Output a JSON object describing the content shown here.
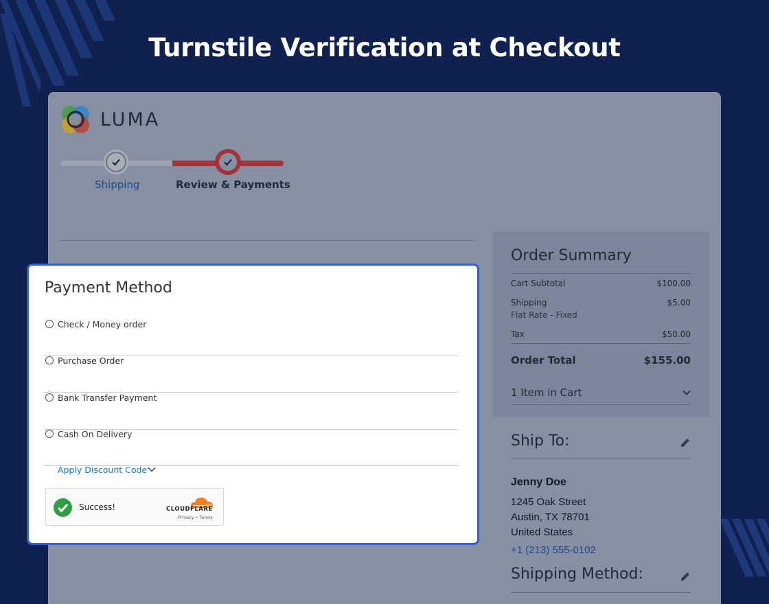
{
  "headline": "Turnstile Verification at Checkout",
  "colors": {
    "background": "#11214f",
    "panel_overlay": "#8790a3",
    "accent_red": "#a3323a",
    "highlight_border": "#2f5fe0",
    "link_blue": "#1979c3",
    "success_green": "#2f9e44",
    "cloudflare_orange": "#f38020"
  },
  "store": {
    "logo_text": "LUMA"
  },
  "progress": {
    "steps": [
      {
        "label": "Shipping",
        "state": "complete"
      },
      {
        "label": "Review & Payments",
        "state": "active"
      }
    ]
  },
  "payment": {
    "title": "Payment Method",
    "options": [
      {
        "label": "Check / Money order",
        "selected": false
      },
      {
        "label": "Purchase Order",
        "selected": false
      },
      {
        "label": "Bank Transfer Payment",
        "selected": false
      },
      {
        "label": "Cash On Delivery",
        "selected": false
      }
    ],
    "discount_label": "Apply Discount Code",
    "turnstile": {
      "status": "Success!",
      "brand": "CLOUDFLARE",
      "links": "Privacy • Terms"
    }
  },
  "summary": {
    "title": "Order Summary",
    "subtotal_label": "Cart Subtotal",
    "subtotal_value": "$100.00",
    "shipping_label": "Shipping",
    "shipping_value": "$5.00",
    "shipping_method": "Flat Rate - Fixed",
    "tax_label": "Tax",
    "tax_value": "$50.00",
    "total_label": "Order Total",
    "total_value": "$155.00",
    "items_label": "1 Item in Cart"
  },
  "ship_to": {
    "title": "Ship To:",
    "name": "Jenny Doe",
    "street": "1245 Oak Street",
    "city": "Austin, TX 78701",
    "country": "United States",
    "phone": "+1 (213) 555-0102"
  },
  "shipping_method": {
    "title": "Shipping Method:"
  },
  "icons": [
    "luma-logo-icon",
    "check-icon",
    "chevron-down-icon",
    "pencil-icon",
    "success-check-icon",
    "cloudflare-cloud-icon"
  ]
}
